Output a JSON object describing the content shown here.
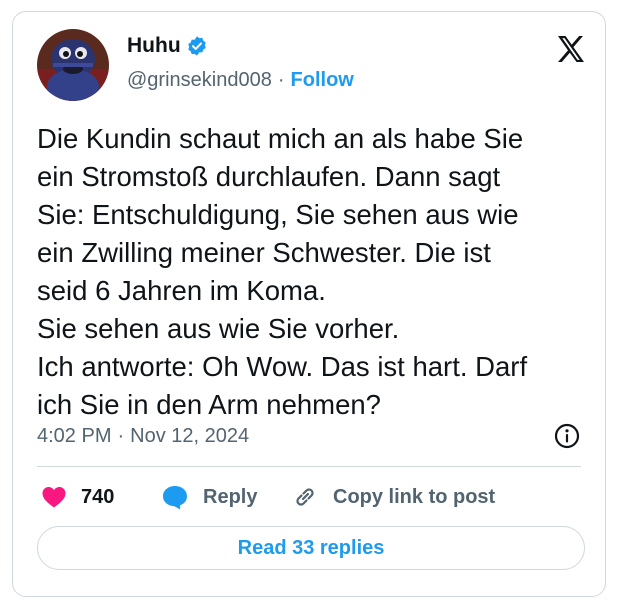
{
  "user": {
    "display_name": "Huhu",
    "handle": "@grinsekind008",
    "separator": "·",
    "follow_label": "Follow"
  },
  "tweet": {
    "lines": [
      "Die Kundin schaut mich an als habe Sie",
      "ein Stromstoß durchlaufen. Dann sagt",
      "Sie: Entschuldigung, Sie sehen aus wie",
      "ein Zwilling meiner Schwester. Die ist",
      "seid 6 Jahren im Koma.",
      "Sie sehen aus wie Sie vorher.",
      "Ich antworte: Oh Wow. Das ist hart. Darf",
      "ich Sie in den Arm nehmen?"
    ],
    "time": "4:02 PM",
    "separator": "·",
    "date": "Nov 12, 2024"
  },
  "actions": {
    "like_count": "740",
    "reply_label": "Reply",
    "copy_label": "Copy link to post"
  },
  "read_replies_label": "Read 33 replies",
  "colors": {
    "accent": "#1d9bf0",
    "like": "#f91880",
    "text": "#0f1419",
    "muted": "#536471",
    "border": "#cfd9de"
  },
  "icons": [
    "verified-badge-icon",
    "x-logo-icon",
    "info-icon",
    "heart-icon",
    "reply-bubble-icon",
    "link-icon"
  ]
}
